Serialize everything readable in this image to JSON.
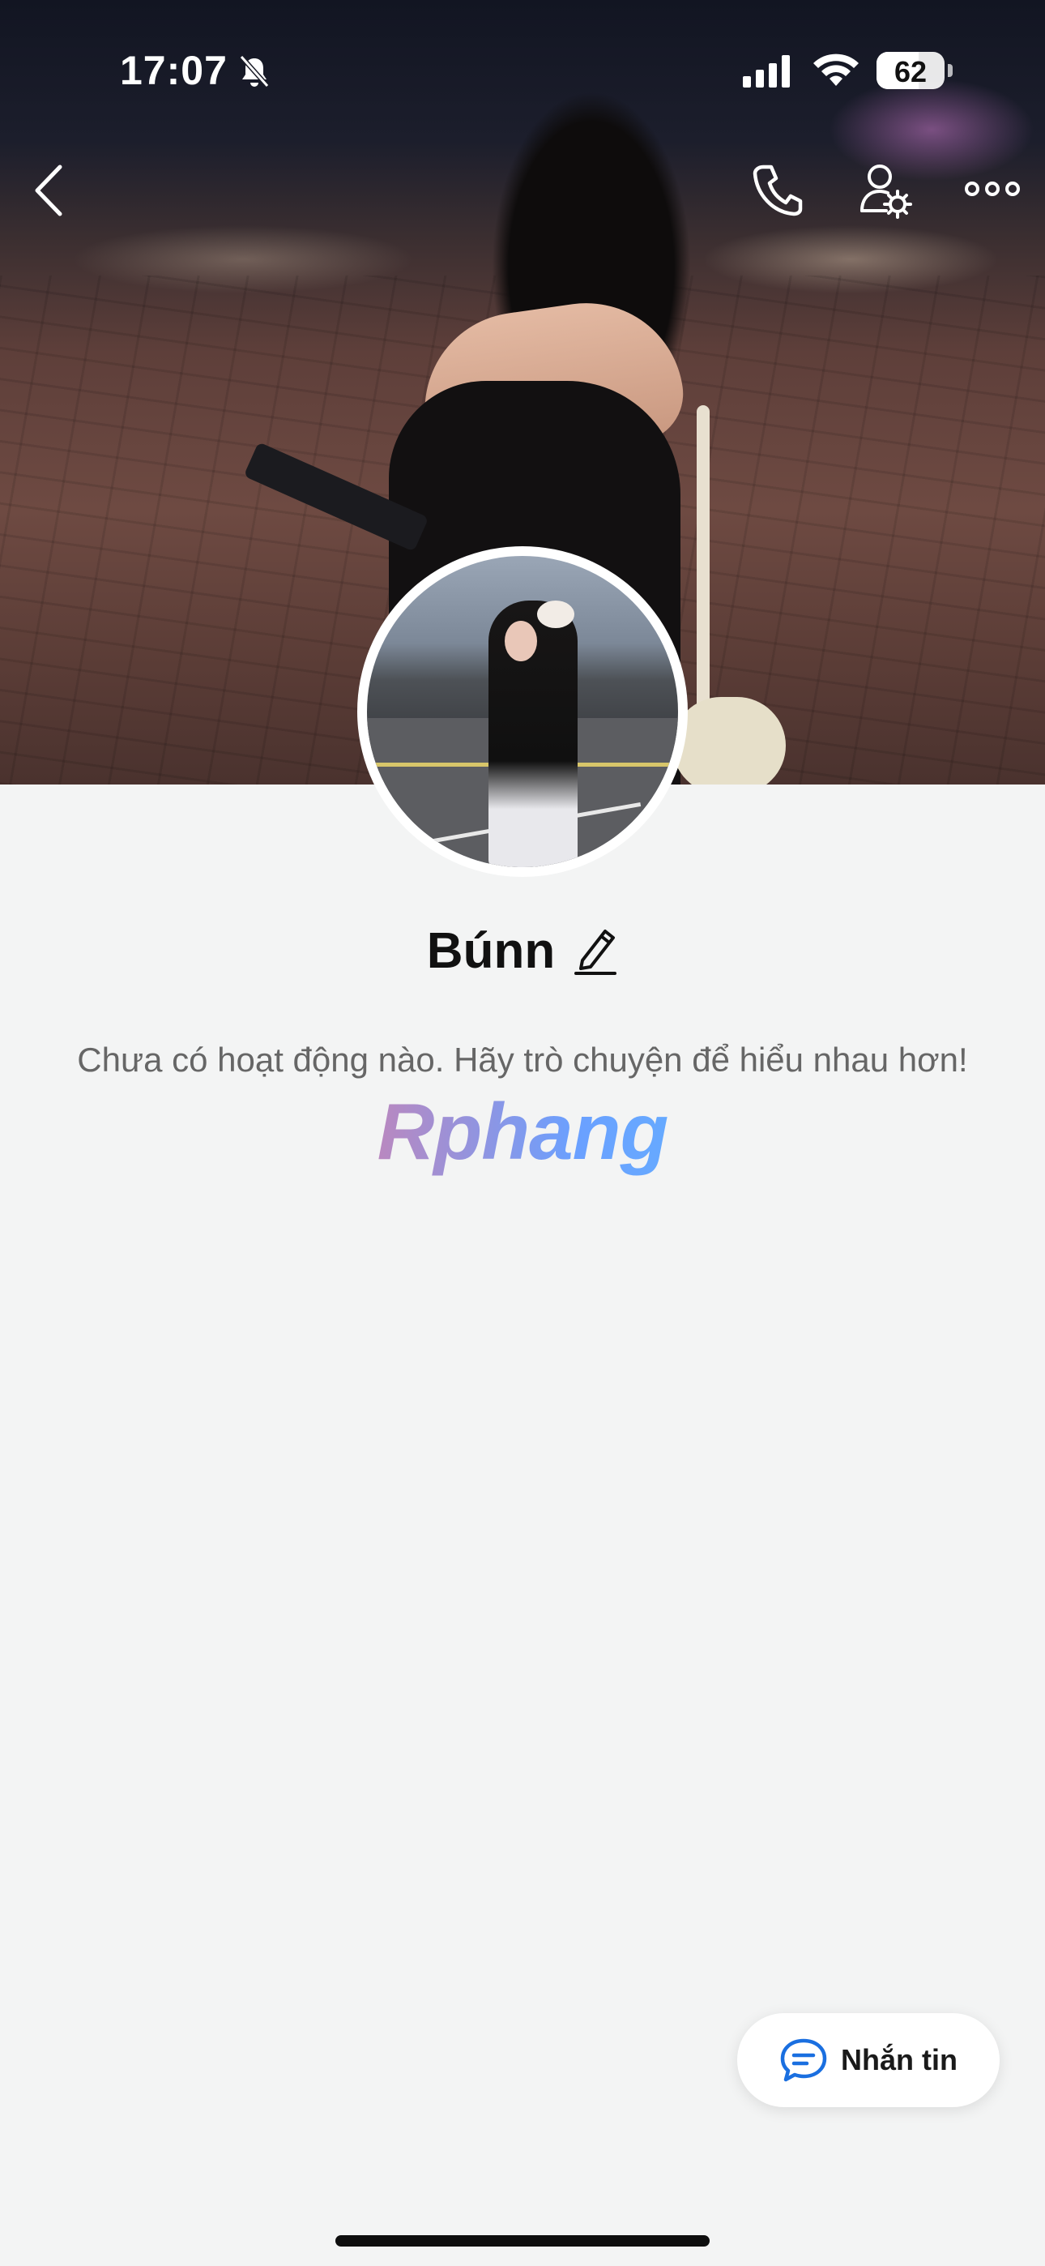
{
  "status_bar": {
    "time": "17:07",
    "battery_level": "62",
    "battery_percent": 62
  },
  "header": {
    "back_icon": "chevron-left-icon",
    "call_icon": "phone-icon",
    "settings_icon": "user-settings-icon",
    "more_icon": "more-horizontal-icon"
  },
  "profile": {
    "name": "Búnn",
    "edit_icon": "pencil-icon",
    "empty_message": "Chưa có hoạt động nào. Hãy trò chuyện để hiểu nhau hơn!"
  },
  "watermark": "Rphang",
  "message_button": {
    "label": "Nhắn tin",
    "icon": "chat-bubble-icon",
    "accent_color": "#1a6fe0"
  }
}
